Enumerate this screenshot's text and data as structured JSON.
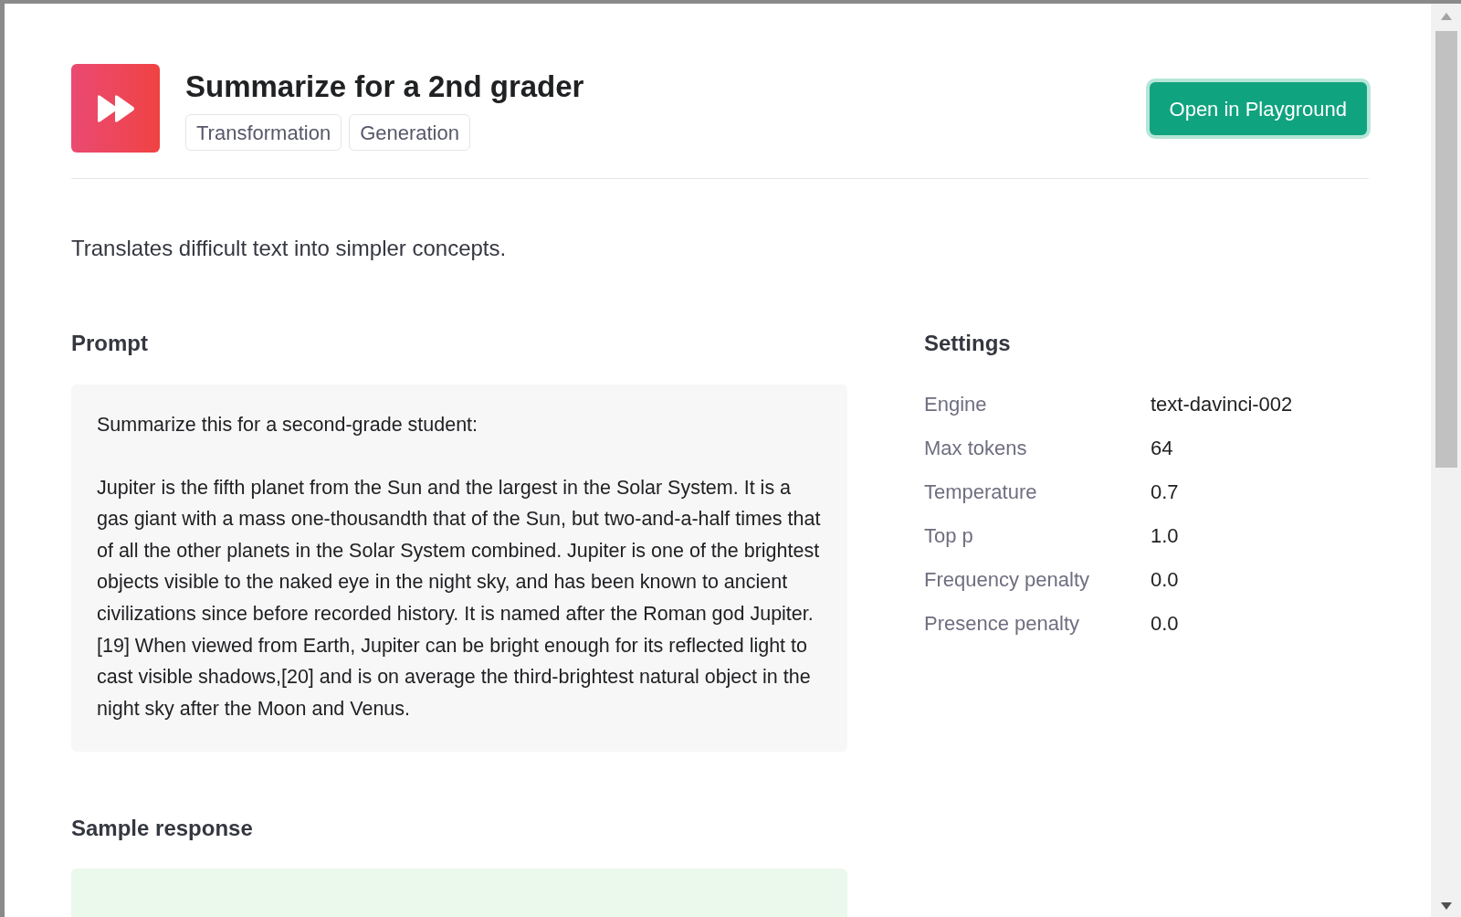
{
  "header": {
    "title": "Summarize for a 2nd grader",
    "tags": [
      "Transformation",
      "Generation"
    ],
    "button": "Open in Playground"
  },
  "description": "Translates difficult text into simpler concepts.",
  "prompt": {
    "heading": "Prompt",
    "paragraphs": [
      "Summarize this for a second-grade student:",
      "Jupiter is the fifth planet from the Sun and the largest in the Solar System. It is a gas giant with a mass one-thousandth that of the Sun, but two-and-a-half times that of all the other planets in the Solar System combined. Jupiter is one of the brightest objects visible to the naked eye in the night sky, and has been known to ancient civilizations since before recorded history. It is named after the Roman god Jupiter.[19] When viewed from Earth, Jupiter can be bright enough for its reflected light to cast visible shadows,[20] and is on average the third-brightest natural object in the night sky after the Moon and Venus."
    ]
  },
  "settings": {
    "heading": "Settings",
    "rows": [
      {
        "label": "Engine",
        "value": "text-davinci-002"
      },
      {
        "label": "Max tokens",
        "value": "64"
      },
      {
        "label": "Temperature",
        "value": "0.7"
      },
      {
        "label": "Top p",
        "value": "1.0"
      },
      {
        "label": "Frequency penalty",
        "value": "0.0"
      },
      {
        "label": "Presence penalty",
        "value": "0.0"
      }
    ]
  },
  "sample_response": {
    "heading": "Sample response"
  }
}
